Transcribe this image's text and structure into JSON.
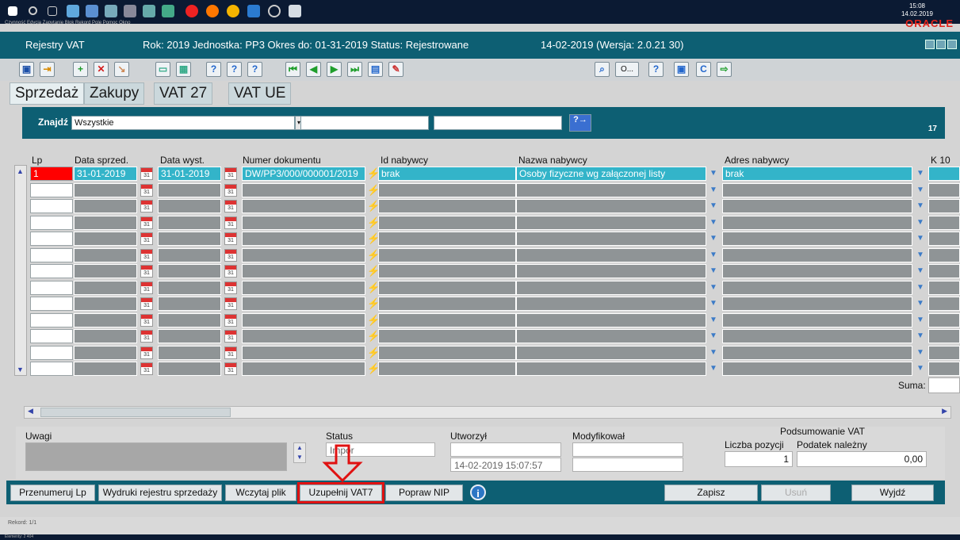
{
  "os": {
    "menubar": "Czynność  Edycja  Zapytanie  Blok  Rekord  Pole  Pomoc  Okno",
    "oracle": "ORACLE",
    "time": "15:08",
    "date": "14.02.2019"
  },
  "header": {
    "title": "Rejestry VAT",
    "context": "Rok: 2019 Jednostka: PP3 Okres do: 01-31-2019 Status: Rejestrowane",
    "version": "14-02-2019 (Wersja: 2.0.21 30)"
  },
  "toolbar": {
    "ident_field": "O..."
  },
  "tabs": [
    "Sprzedaż",
    "Zakupy",
    "VAT 27",
    "VAT UE"
  ],
  "filter": {
    "label": "Znajdź",
    "value": "Wszystkie",
    "count": "17"
  },
  "grid": {
    "columns": [
      "Lp",
      "Data sprzed.",
      "Data wyst.",
      "Numer dokumentu",
      "Id nabywcy",
      "Nazwa nabywcy",
      "Adres nabywcy",
      "K 10"
    ],
    "calendar_day": "31",
    "rows": [
      {
        "lp": "1",
        "data_sprzed": "31-01-2019",
        "data_wyst": "31-01-2019",
        "numer": "DW/PP3/000/000001/2019",
        "id": "brak",
        "nazwa": "Osoby fizyczne wg załączonej listy",
        "adres": "brak"
      },
      {
        "lp": "",
        "data_sprzed": "",
        "data_wyst": "",
        "numer": "",
        "id": "",
        "nazwa": "",
        "adres": ""
      },
      {
        "lp": "",
        "data_sprzed": "",
        "data_wyst": "",
        "numer": "",
        "id": "",
        "nazwa": "",
        "adres": ""
      },
      {
        "lp": "",
        "data_sprzed": "",
        "data_wyst": "",
        "numer": "",
        "id": "",
        "nazwa": "",
        "adres": ""
      },
      {
        "lp": "",
        "data_sprzed": "",
        "data_wyst": "",
        "numer": "",
        "id": "",
        "nazwa": "",
        "adres": ""
      },
      {
        "lp": "",
        "data_sprzed": "",
        "data_wyst": "",
        "numer": "",
        "id": "",
        "nazwa": "",
        "adres": ""
      },
      {
        "lp": "",
        "data_sprzed": "",
        "data_wyst": "",
        "numer": "",
        "id": "",
        "nazwa": "",
        "adres": ""
      },
      {
        "lp": "",
        "data_sprzed": "",
        "data_wyst": "",
        "numer": "",
        "id": "",
        "nazwa": "",
        "adres": ""
      },
      {
        "lp": "",
        "data_sprzed": "",
        "data_wyst": "",
        "numer": "",
        "id": "",
        "nazwa": "",
        "adres": ""
      },
      {
        "lp": "",
        "data_sprzed": "",
        "data_wyst": "",
        "numer": "",
        "id": "",
        "nazwa": "",
        "adres": ""
      },
      {
        "lp": "",
        "data_sprzed": "",
        "data_wyst": "",
        "numer": "",
        "id": "",
        "nazwa": "",
        "adres": ""
      },
      {
        "lp": "",
        "data_sprzed": "",
        "data_wyst": "",
        "numer": "",
        "id": "",
        "nazwa": "",
        "adres": ""
      },
      {
        "lp": "",
        "data_sprzed": "",
        "data_wyst": "",
        "numer": "",
        "id": "",
        "nazwa": "",
        "adres": ""
      }
    ],
    "suma_label": "Suma:"
  },
  "form": {
    "uwagi_label": "Uwagi",
    "status_label": "Status",
    "status_value": "Impor",
    "utworzyl_label": "Utworzył",
    "utworzyl_date": "14-02-2019 15:07:57",
    "modyfikowal_label": "Modyfikował",
    "summary_title": "Podsumowanie VAT",
    "liczba_label": "Liczba pozycji",
    "liczba_value": "1",
    "podatek_label": "Podatek należny",
    "podatek_value": "0,00"
  },
  "actions": {
    "przenumeruj": "Przenumeruj Lp",
    "wydruki": "Wydruki rejestru sprzedaży",
    "wczytaj": "Wczytaj plik",
    "uzupelnij": "Uzupełnij VAT7",
    "popraw": "Popraw NIP",
    "info": "i",
    "zapisz": "Zapisz",
    "usun": "Usuń",
    "wyjdz": "Wyjdź"
  },
  "status": {
    "rekord": "Rekord: 1/1",
    "elements": "Elementy: 2 404"
  },
  "colors": {
    "accent": "#0d5f73",
    "selected_row": "#33b4c9",
    "highlight": "#e01111"
  }
}
